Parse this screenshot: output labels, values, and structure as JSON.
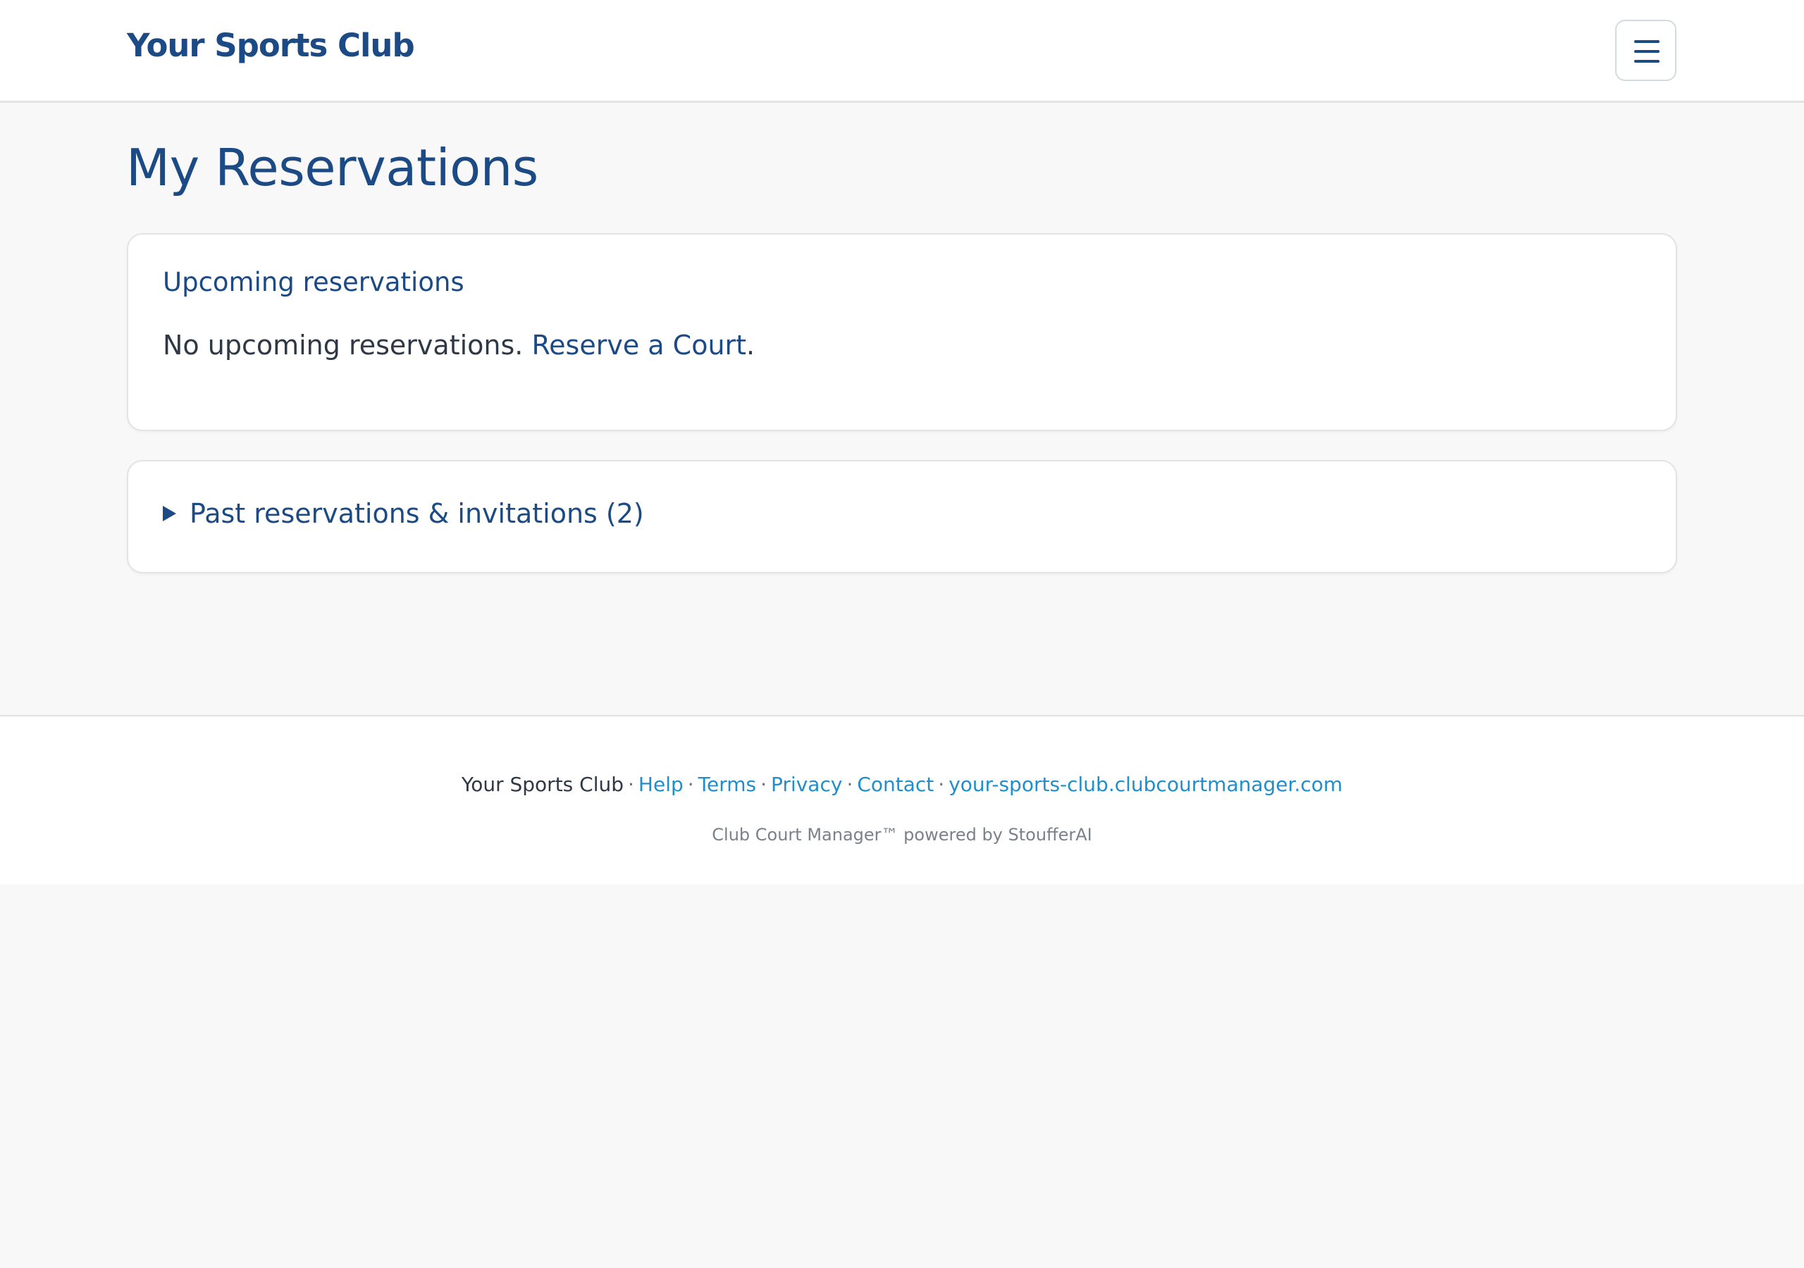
{
  "header": {
    "brand": "Your Sports Club",
    "menu_icon": "hamburger-menu-icon"
  },
  "main": {
    "title": "My Reservations",
    "upcoming": {
      "heading": "Upcoming reservations",
      "empty_text": "No upcoming reservations.",
      "reserve_link": "Reserve a Court",
      "trailing_period": "."
    },
    "past": {
      "toggle_icon": "triangle-right-icon",
      "label": "Past reservations & invitations (2)"
    }
  },
  "footer": {
    "club_name": "Your Sports Club",
    "separator": "·",
    "links": {
      "help": "Help",
      "terms": "Terms",
      "privacy": "Privacy",
      "contact": "Contact",
      "domain": "your-sports-club.clubcourtmanager.com"
    },
    "credit": "Club Court Manager™ powered by StoufferAI"
  },
  "colors": {
    "brand_blue": "#1c4a84",
    "link_blue": "#1f8ecb",
    "page_bg": "#f8f8f8"
  }
}
